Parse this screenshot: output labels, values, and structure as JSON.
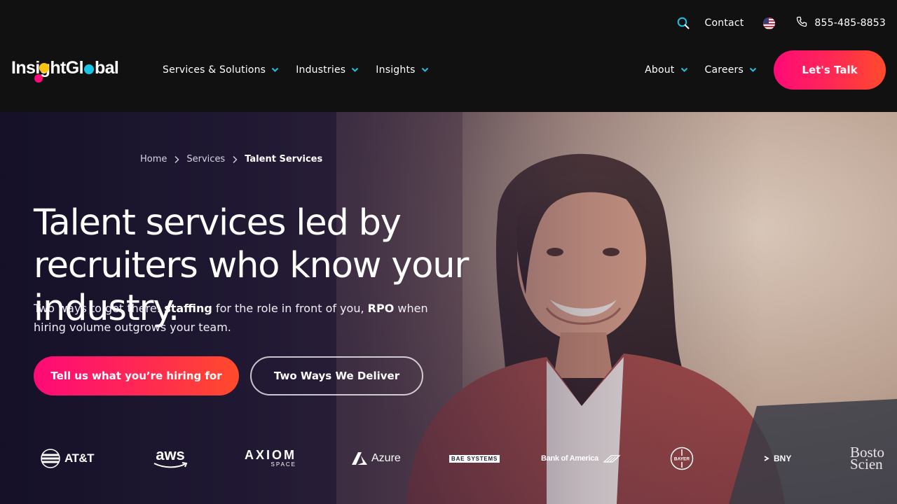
{
  "utility": {
    "contact": "Contact",
    "phone": "855-485-8853"
  },
  "logo": {
    "part1": "Insi",
    "part2": "ght",
    "part3": "Gl",
    "part4": "bal",
    "dot_colors": [
      "#ffc20e",
      "#ff0a78",
      "#19c3e6"
    ]
  },
  "nav": {
    "left": [
      "Services & Solutions",
      "Industries",
      "Insights"
    ],
    "right": [
      "About",
      "Careers"
    ],
    "chevron_color": "#19c3e6",
    "cta": "Let's Talk"
  },
  "breadcrumb": {
    "home": "Home",
    "services": "Services",
    "current": "Talent Services"
  },
  "hero": {
    "title": "Talent services led by recruiters who know your industry.",
    "sub_1": "Two ways to get there: ",
    "sub_bold_1": "staffing",
    "sub_2": " for the role in front of you, ",
    "sub_bold_2": "RPO",
    "sub_3": " when hiring volume outgrows your team.",
    "primary_button": "Tell us what you’re hiring for",
    "secondary_button": "Two Ways We Deliver"
  },
  "clients": {
    "att": "AT&T",
    "aws": "aws",
    "axiom": "AXIOM",
    "axiom_sub": "SPACE",
    "azure": "Azure",
    "bae": "BAE SYSTEMS",
    "boa": "Bank of America",
    "bayer": "BAYER",
    "bny": "BNY",
    "bsci_1": "Bosto",
    "bsci_2": "Scien"
  },
  "colors": {
    "accent_pink": "#ff0a78",
    "accent_orange": "#ff4b2b",
    "accent_cyan": "#19c3e6",
    "header_bg": "#111111"
  }
}
